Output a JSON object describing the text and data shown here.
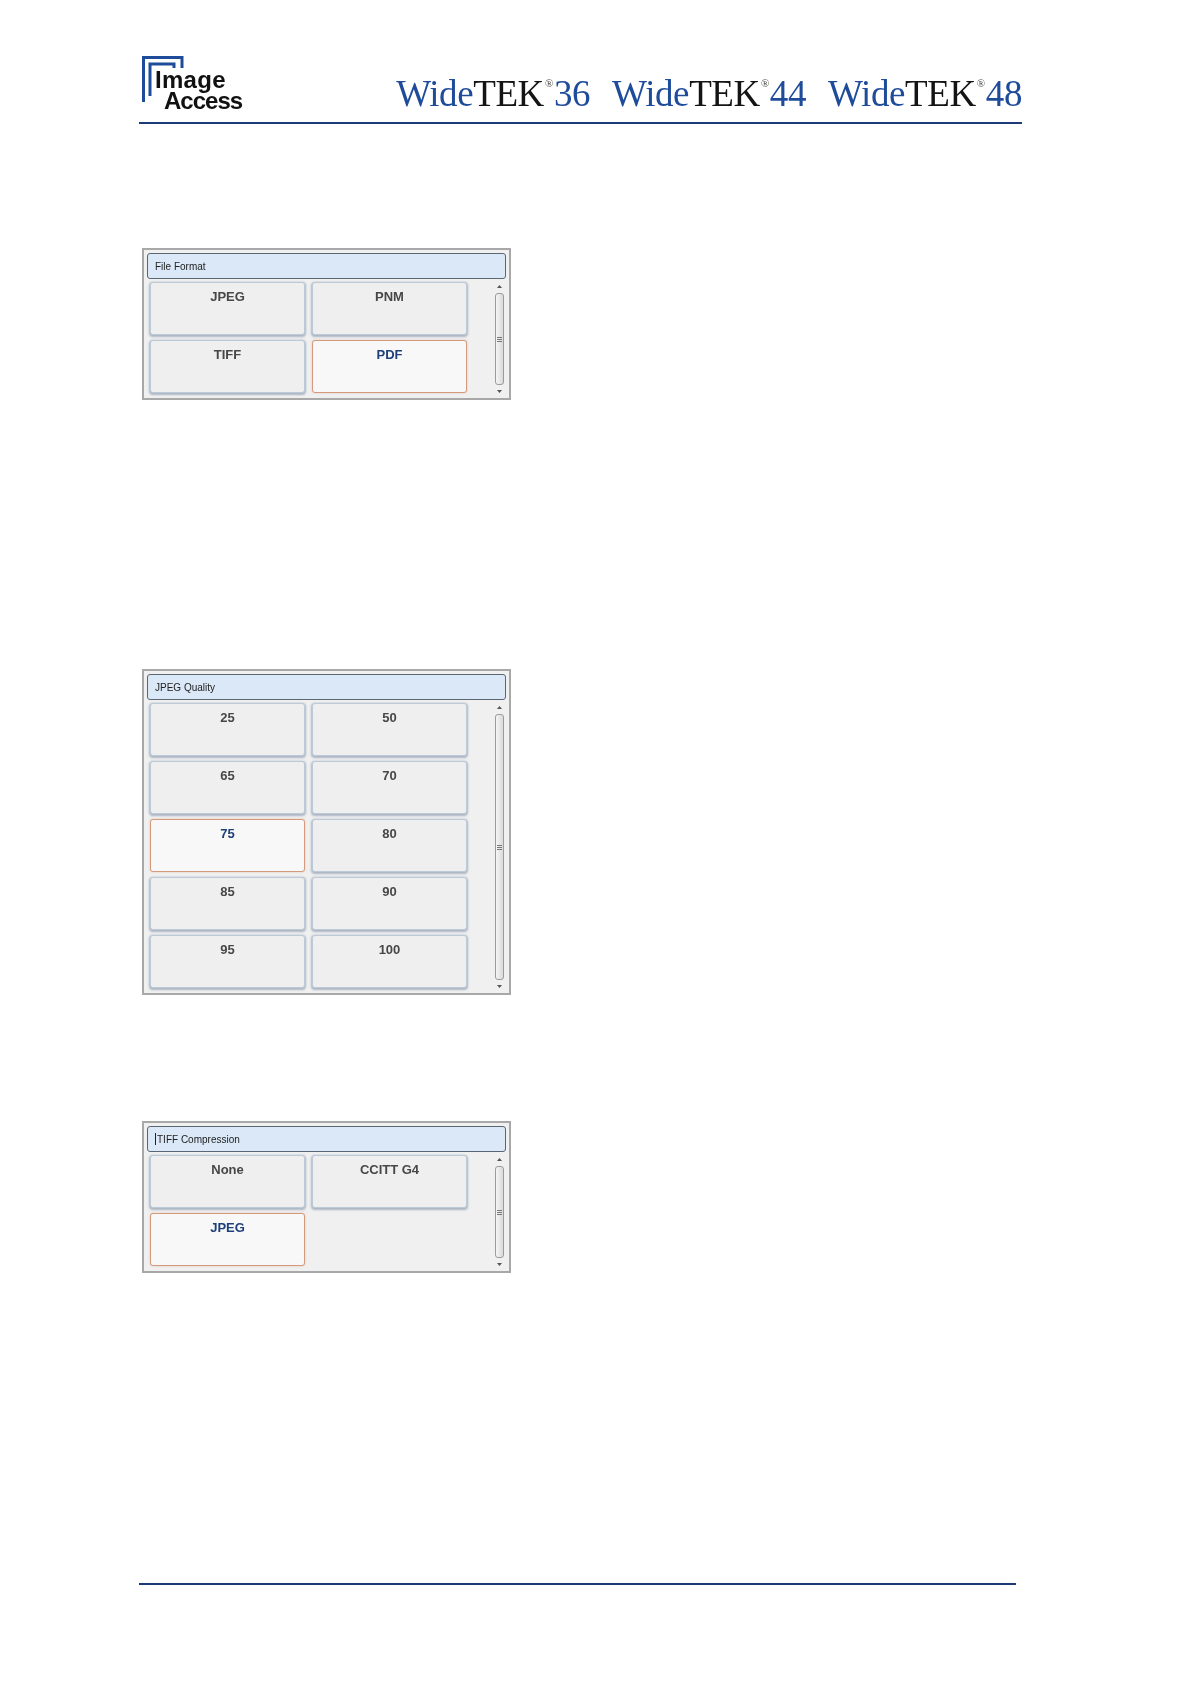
{
  "header": {
    "logo": {
      "line_1": "Image",
      "line_2": "Access"
    },
    "products": [
      {
        "prefix": "Wide",
        "brand": "TEK",
        "mark": "®",
        "model": "36"
      },
      {
        "prefix": "Wide",
        "brand": "TEK",
        "mark": "®",
        "model": "44"
      },
      {
        "prefix": "Wide",
        "brand": "TEK",
        "mark": "®",
        "model": "48"
      }
    ]
  },
  "panels": [
    {
      "title": "File Format",
      "text_cursor": false,
      "options": [
        {
          "label": "JPEG",
          "selected": false
        },
        {
          "label": "PNM",
          "selected": false
        },
        {
          "label": "TIFF",
          "selected": false
        },
        {
          "label": "PDF",
          "selected": true
        }
      ]
    },
    {
      "title": "JPEG Quality",
      "text_cursor": false,
      "options": [
        {
          "label": "25",
          "selected": false
        },
        {
          "label": "50",
          "selected": false
        },
        {
          "label": "65",
          "selected": false
        },
        {
          "label": "70",
          "selected": false
        },
        {
          "label": "75",
          "selected": true
        },
        {
          "label": "80",
          "selected": false
        },
        {
          "label": "85",
          "selected": false
        },
        {
          "label": "90",
          "selected": false
        },
        {
          "label": "95",
          "selected": false
        },
        {
          "label": "100",
          "selected": false
        }
      ]
    },
    {
      "title": "TIFF Compression",
      "text_cursor": true,
      "options": [
        {
          "label": "None",
          "selected": false
        },
        {
          "label": "CCITT G4",
          "selected": false
        },
        {
          "label": "JPEG",
          "selected": true
        }
      ]
    }
  ]
}
